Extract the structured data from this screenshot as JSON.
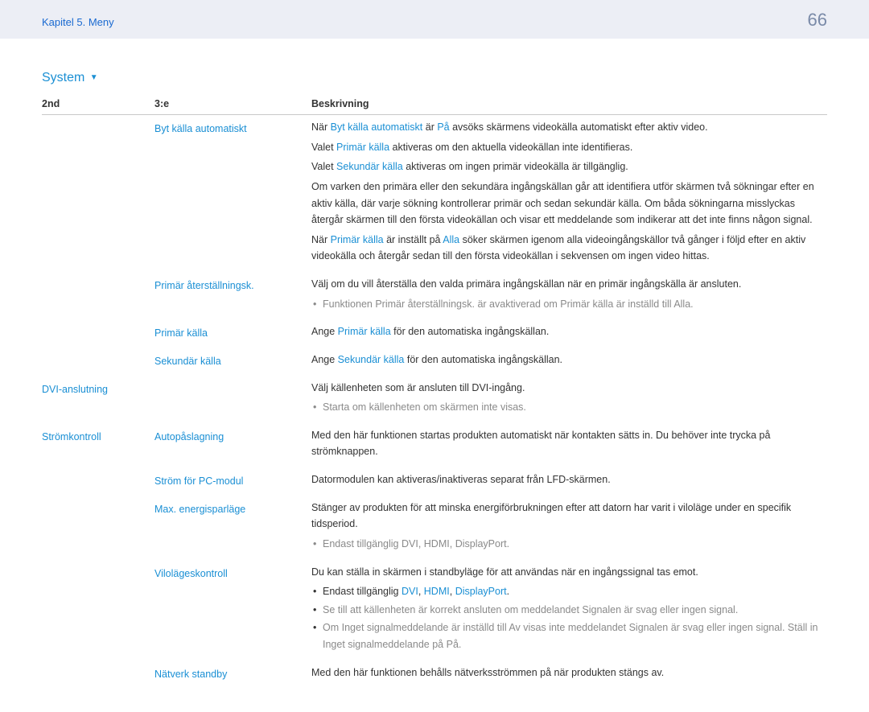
{
  "header": {
    "chapter": "Kapitel 5. Meny",
    "page": "66"
  },
  "sectionTitle": "System",
  "columns": {
    "c1": "2nd",
    "c2": "3:e",
    "c3": "Beskrivning"
  },
  "t": {
    "byt": "Byt källa automatiskt",
    "primAter": "Primär återställningsk.",
    "primKalla": "Primär källa",
    "sekKalla": "Sekundär källa",
    "dviAnsl": "DVI-anslutning",
    "stromK": "Strömkontroll",
    "autoPa": "Autopåslagning",
    "stromPC": "Ström för PC-modul",
    "maxEner": "Max. energisparläge",
    "vilo": "Vilolägeskontroll",
    "natverk": "Nätverk standby",
    "pa": "På",
    "alla": "Alla",
    "av": "Av",
    "dvi": "DVI",
    "hdmi": "HDMI",
    "dp": "DisplayPort",
    "sigSvag": "Signalen är svag eller ingen signal",
    "ingetSig": "Inget signalmeddelande",
    "r1p1a": "När ",
    "r1p1b": " är ",
    "r1p1c": " avsöks skärmens videokälla automatiskt efter aktiv video.",
    "r1p2a": "Valet ",
    "r1p2b": " aktiveras om den aktuella videokällan inte identifieras.",
    "r1p3b": " aktiveras om ingen primär videokälla är tillgänglig.",
    "r1p4": "Om varken den primära eller den sekundära ingångskällan går att identifiera utför skärmen två sökningar efter en aktiv källa, där varje sökning kontrollerar primär och sedan sekundär källa. Om båda sökningarna misslyckas återgår skärmen till den första videokällan och visar ett meddelande som indikerar att det inte finns någon signal.",
    "r1p5b": " är inställt på ",
    "r1p5c": " söker skärmen igenom alla videoingångskällor två gånger i följd efter en aktiv videokälla och återgår sedan till den första videokällan i sekvensen om ingen video hittas.",
    "r2p1": "Välj om du vill återställa den valda primära ingångskällan när en primär ingångskälla är ansluten.",
    "r2liA": "Funktionen ",
    "r2liB": " är avaktiverad om ",
    "r2liC": " är inställd till ",
    "r3a": "Ange ",
    "r3b": " för den automatiska ingångskällan.",
    "r5p1": "Välj källenheten som är ansluten till DVI-ingång.",
    "r5li": "Starta om källenheten om skärmen inte visas.",
    "r6p1": "Med den här funktionen startas produkten automatiskt när kontakten sätts in. Du behöver inte trycka på strömknappen.",
    "r7p1": "Datormodulen kan aktiveras/inaktiveras separat från LFD-skärmen.",
    "r8p1": "Stänger av produkten för att minska energiförbrukningen efter att datorn har varit i viloläge under en specifik tidsperiod.",
    "r8li": "Endast tillgänglig ",
    "r9p1": "Du kan ställa in skärmen i standbyläge för att användas när en ingångssignal tas emot.",
    "r9li2a": "Se till att källenheten är korrekt ansluten om meddelandet ",
    "r9li3a": "Om ",
    "r9li3b": " är inställd till ",
    "r9li3c": " visas inte meddelandet ",
    "r9li3d": ". Ställ in ",
    "r9li3e": " på ",
    "r10p1": "Med den här funktionen behålls nätverksströmmen på när produkten stängs av."
  }
}
